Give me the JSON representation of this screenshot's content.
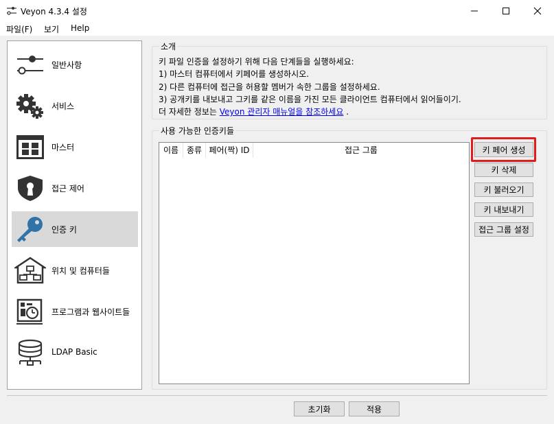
{
  "window": {
    "title": "Veyon  4.3.4 설정",
    "icon": "sliders-icon"
  },
  "menu": [
    "파일(F)",
    "보기",
    "Help"
  ],
  "sidebar": {
    "items": [
      {
        "label": "일반사항",
        "icon": "sliders-icon",
        "active": false
      },
      {
        "label": "서비스",
        "icon": "gears-icon",
        "active": false
      },
      {
        "label": "마스터",
        "icon": "grid-window-icon",
        "active": false
      },
      {
        "label": "접근 제어",
        "icon": "shield-lock-icon",
        "active": false
      },
      {
        "label": "인증 키",
        "icon": "key-icon",
        "active": true
      },
      {
        "label": "위치 및 컴퓨터들",
        "icon": "network-house-icon",
        "active": false
      },
      {
        "label": "프로그램과 웹사이트들",
        "icon": "program-clock-icon",
        "active": false
      },
      {
        "label": "LDAP Basic",
        "icon": "database-network-icon",
        "active": false
      }
    ]
  },
  "intro": {
    "title": "소개",
    "lines": [
      "키 파일 인증을 설정하기 위해 다음 단계들을 실행하세요:",
      "1) 마스터 컴퓨터에서 키페어를 생성하시오.",
      "2) 다른 컴퓨터에 접근을 허용할 멤버가 속한 그룹을 설정하세요.",
      "3) 공개키를 내보내고 그키를 같은 이름을 가진 모든 클라이언트 컴퓨터에서 읽어들이기."
    ],
    "more_prefix": "더 자세한 정보는",
    "more_link": "Veyon 관리자 매뉴얼을 참조하세요",
    "more_suffix": "."
  },
  "keys": {
    "title": "사용 가능한 인증키들",
    "columns": [
      "이름",
      "종류",
      "페어(짝) ID",
      "접근 그룹"
    ],
    "rows": []
  },
  "buttons": {
    "create_pair": "키 페어 생성",
    "delete": "키 삭제",
    "import": "키 불러오기",
    "export": "키 내보내기",
    "set_access_group": "접근 그룹 설정"
  },
  "footer": {
    "reset": "초기화",
    "apply": "적용"
  },
  "colors": {
    "highlight": "#e01b1b",
    "icon_blue": "#2f73a8",
    "link": "#0000ee",
    "active_bg": "#d9d9d9"
  }
}
